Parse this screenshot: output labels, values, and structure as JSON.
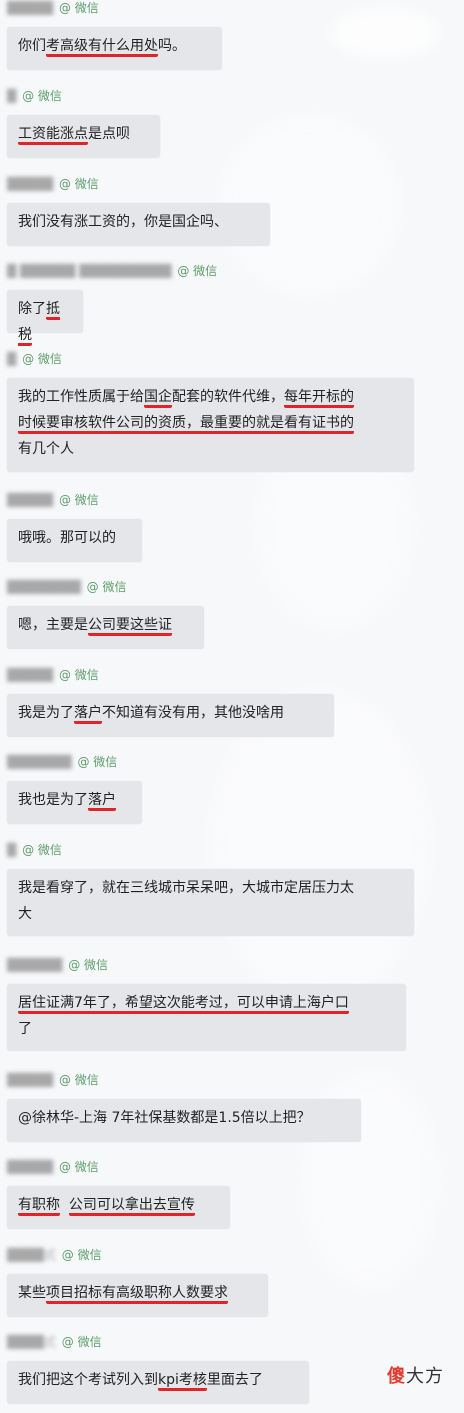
{
  "source_label": "@ 微信",
  "messages": [
    {
      "sender": "█████",
      "parts": [
        {
          "t": "你们"
        },
        {
          "t": "考高级有什么用处",
          "u": true
        },
        {
          "t": "吗。"
        }
      ]
    },
    {
      "sender": "█",
      "parts": [
        {
          "t": "工资能涨点",
          "u": true
        },
        {
          "t": "是点呗"
        }
      ]
    },
    {
      "sender": "█████",
      "parts": [
        {
          "t": "我们没有涨工资的，你是国企吗、"
        }
      ]
    },
    {
      "sender": "█ ██████ ██████████",
      "parts": [
        {
          "t": "除了"
        },
        {
          "t": "抵税",
          "u": true
        }
      ]
    },
    {
      "sender": "█",
      "lines": [
        [
          {
            "t": "我的工作性质属于给"
          },
          {
            "t": "国企",
            "u": true
          },
          {
            "t": "配套的软件代维，"
          },
          {
            "t": "每年开标的",
            "u": true
          }
        ],
        [
          {
            "t": "时候要审核软件公司的资质，最重要的就是看有证书的",
            "u": true
          }
        ],
        [
          {
            "t": "有几个人"
          }
        ]
      ]
    },
    {
      "sender": "█████",
      "parts": [
        {
          "t": "哦哦。那可以的"
        }
      ]
    },
    {
      "sender": "████████",
      "parts": [
        {
          "t": "嗯，主要是"
        },
        {
          "t": "公司要这些证",
          "u": true
        }
      ]
    },
    {
      "sender": "█████",
      "parts": [
        {
          "t": "我是为了"
        },
        {
          "t": "落户",
          "u": true
        },
        {
          "t": "不知道有没有用，其他没啥用"
        }
      ]
    },
    {
      "sender": "███████",
      "parts": [
        {
          "t": "我也是为了"
        },
        {
          "t": "落户",
          "u": true
        }
      ]
    },
    {
      "sender": "█",
      "lines": [
        [
          {
            "t": "我是看穿了，就在三线城市呆呆吧，大城市定居压力太"
          }
        ],
        [
          {
            "t": "大"
          }
        ]
      ]
    },
    {
      "sender": "██████",
      "lines": [
        [
          {
            "t": "居住证满7年了，希望这次能考过，可以申请上海户口",
            "u": true
          }
        ],
        [
          {
            "t": "了"
          }
        ]
      ]
    },
    {
      "sender": "█████",
      "parts": [
        {
          "t": "@徐林华-上海 7年社保基数都是1.5倍以上把？"
        }
      ]
    },
    {
      "sender": "█████",
      "parts": [
        {
          "t": "有职称",
          "u": true
        },
        {
          "t": "  "
        },
        {
          "t": "公司可以拿出去宣传",
          "u": true
        }
      ]
    },
    {
      "sender": "████式",
      "parts": [
        {
          "t": "某些"
        },
        {
          "t": "项目招标有高级职称人数要求",
          "u": true
        }
      ]
    },
    {
      "sender": "████式",
      "parts": [
        {
          "t": "我们把这个考试列入到"
        },
        {
          "t": "kpi考核",
          "u": true
        },
        {
          "t": "里面去了"
        }
      ]
    }
  ],
  "watermark": {
    "first_char": "傻",
    "rest": "大方"
  }
}
